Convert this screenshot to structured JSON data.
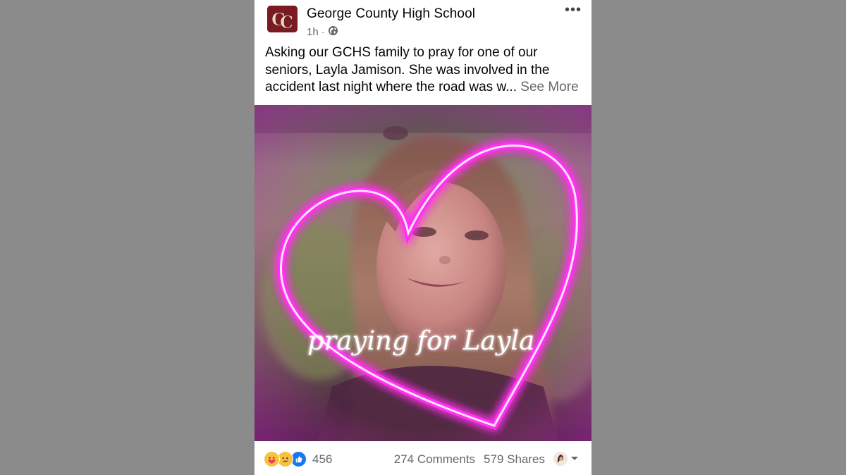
{
  "post": {
    "page_name": "George County High School",
    "logo_text": "GC",
    "time": "1h",
    "separator": "·",
    "audience_icon": "globe-icon",
    "more_icon": "more-horizontal-icon",
    "body_text": "Asking our GCHS family to pray for one of our seniors, Layla Jamison.  She was involved in the accident last night where the road was w...",
    "see_more_label": "See More",
    "image": {
      "overlay_text": "praying for Layla",
      "frame": "neon-heart",
      "glow_color": "#ff3df0"
    }
  },
  "footer": {
    "reaction_icons": [
      "care-emoji-icon",
      "sad-emoji-icon",
      "like-icon"
    ],
    "reaction_count": "456",
    "comments_label": "274 Comments",
    "shares_label": "579 Shares",
    "viewer_icon": "avatar",
    "dropdown_icon": "chevron-down-icon"
  },
  "colors": {
    "background": "#8b8b8b",
    "card": "#ffffff",
    "text_primary": "#050505",
    "text_secondary": "#65676b",
    "brand_maroon": "#7a1a22",
    "like_blue": "#1877f2"
  }
}
